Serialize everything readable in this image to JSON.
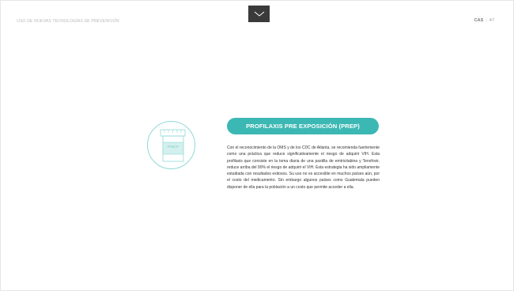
{
  "header": {
    "section_title": "USO DE NUEVAS TECNOLOGÍAS DE PREVENCIÓN",
    "doc_code": "CAS",
    "separator": "|",
    "page_number": "47"
  },
  "nav": {
    "toggle_icon": "chevron-down-icon"
  },
  "illustration": {
    "icon": "pill-bottle-icon",
    "label": "PREP"
  },
  "section": {
    "title": "PROFILAXIS PRE EXPOSICIÓN (PREP)",
    "body": "Con el reconocimiento de la OMS y de los CDC de Atlanta, se recomienda fuertemente como una práctica que reduce significativamente el riesgo de adquirir VIH. Esta profilaxis que consiste en la toma diaria de una pastilla de emtricitabina y Tenofovir, reduce arriba del 90% el riesgo de adquirir el VIH. Esta estrategia ha sido ampliamente estudiada con resultados exitosos. Su uso no es accesible en muchos países aún, por el costo del medicamento. Sin embargo algunos países como Guatemala pueden disponer de ella para la población a un costo que permite acceder a ella."
  },
  "colors": {
    "accent": "#3cb8b4",
    "accent_light": "#8fd9d6",
    "nav_bg": "#3a3a3a"
  }
}
